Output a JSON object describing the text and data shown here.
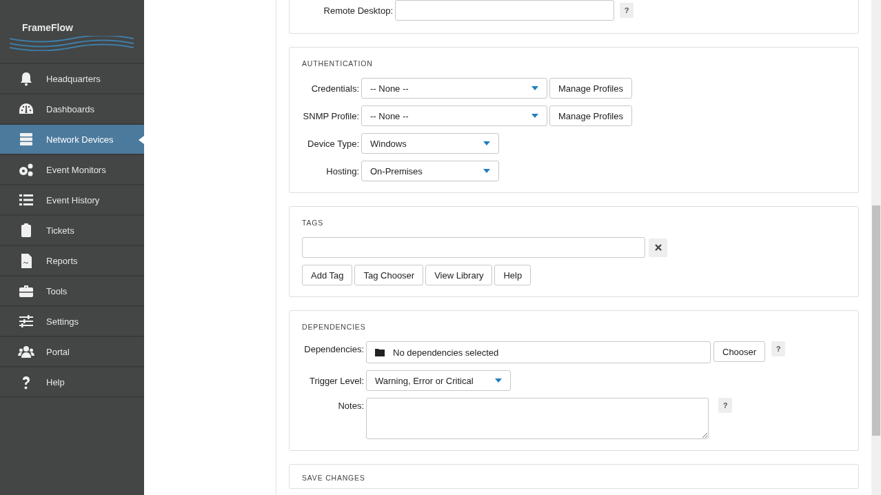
{
  "sidebar": {
    "logo": "FrameFlow",
    "items": [
      {
        "label": "Headquarters",
        "selected": false
      },
      {
        "label": "Dashboards",
        "selected": false
      },
      {
        "label": "Network Devices",
        "selected": true
      },
      {
        "label": "Event Monitors",
        "selected": false
      },
      {
        "label": "Event History",
        "selected": false
      },
      {
        "label": "Tickets",
        "selected": false
      },
      {
        "label": "Reports",
        "selected": false
      },
      {
        "label": "Tools",
        "selected": false
      },
      {
        "label": "Settings",
        "selected": false
      },
      {
        "label": "Portal",
        "selected": false
      },
      {
        "label": "Help",
        "selected": false
      }
    ]
  },
  "sections": [
    {
      "rows": [
        {
          "kind": "input",
          "label": "Remote Desktop:",
          "help": "?"
        }
      ]
    },
    {
      "title": "AUTHENTICATION",
      "rows": [
        {
          "kind": "select",
          "label": "Credentials:",
          "value": "-- None --",
          "button": "Manage Profiles"
        },
        {
          "kind": "select",
          "label": "SNMP Profile:",
          "value": "-- None --",
          "button": "Manage Profiles"
        },
        {
          "kind": "select",
          "label": "Device Type:",
          "value": "Windows"
        },
        {
          "kind": "select",
          "label": "Hosting:",
          "value": "On-Premises"
        }
      ]
    },
    {
      "title": "TAGS",
      "rows": [
        {
          "kind": "tag_input"
        },
        {
          "kind": "buttons",
          "buttons": [
            "Add Tag",
            "Tag Chooser",
            "View Library",
            "Help"
          ]
        }
      ]
    },
    {
      "title": "DEPENDENCIES",
      "rows": [
        {
          "kind": "chooser",
          "label": "Dependencies:",
          "value": "No dependencies selected",
          "button": "Chooser",
          "help": "?"
        },
        {
          "kind": "select",
          "label": "Trigger Level:",
          "value": "Warning, Error or Critical"
        },
        {
          "kind": "textarea",
          "label": "Notes:",
          "help": "?"
        }
      ]
    },
    {
      "title": "SAVE CHANGES"
    }
  ]
}
